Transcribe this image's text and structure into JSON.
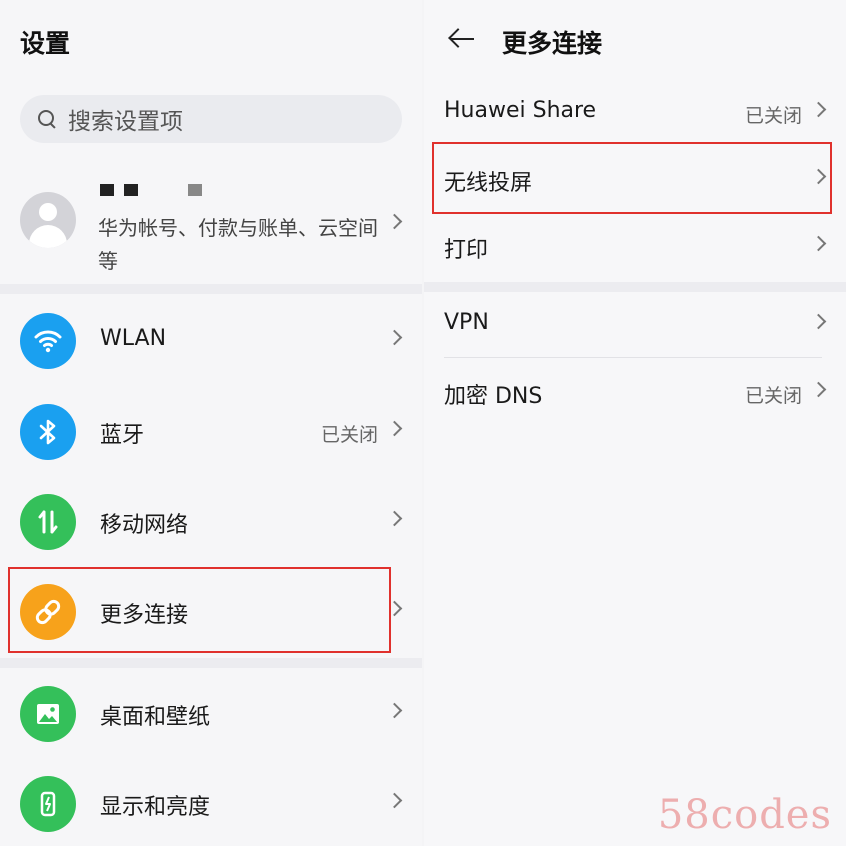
{
  "left": {
    "title": "设置",
    "search": {
      "placeholder": "搜索设置项"
    },
    "account": {
      "description": "华为帐号、付款与账单、云空间等"
    },
    "items": [
      {
        "label": "WLAN",
        "value": "",
        "icon": "wifi-icon",
        "color": "#1aa0f0"
      },
      {
        "label": "蓝牙",
        "value": "已关闭",
        "icon": "bluetooth-icon",
        "color": "#1aa0f0"
      },
      {
        "label": "移动网络",
        "value": "",
        "icon": "mobile-data-icon",
        "color": "#34c05a"
      },
      {
        "label": "更多连接",
        "value": "",
        "icon": "link-icon",
        "color": "#f7a21b"
      },
      {
        "label": "桌面和壁纸",
        "value": "",
        "icon": "wallpaper-icon",
        "color": "#34c05a"
      },
      {
        "label": "显示和亮度",
        "value": "",
        "icon": "brightness-icon",
        "color": "#34c05a"
      }
    ]
  },
  "right": {
    "title": "更多连接",
    "items": [
      {
        "label": "Huawei Share",
        "value": "已关闭"
      },
      {
        "label": "无线投屏",
        "value": ""
      },
      {
        "label": "打印",
        "value": ""
      },
      {
        "label": "VPN",
        "value": ""
      },
      {
        "label": "加密 DNS",
        "value": "已关闭"
      }
    ]
  },
  "watermark": "58codes",
  "colors": {
    "highlight": "#e0312d"
  }
}
